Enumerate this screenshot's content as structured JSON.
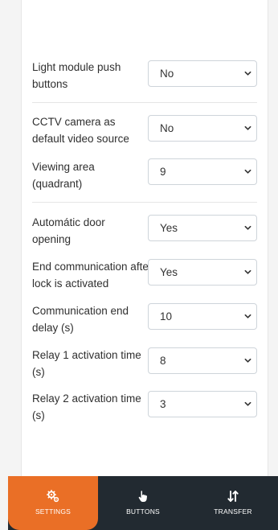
{
  "settings": [
    {
      "label": "Light module push buttons",
      "value": "No"
    },
    {
      "label": "CCTV camera as default video source",
      "value": "No"
    },
    {
      "label": "Viewing area (quadrant)",
      "value": "9"
    },
    {
      "label": "Automátic door opening",
      "value": "Yes"
    },
    {
      "label": "End communication after lock is activated",
      "value": "Yes"
    },
    {
      "label": "Communication end delay (s)",
      "value": "10"
    },
    {
      "label": "Relay 1 activation time (s)",
      "value": "8"
    },
    {
      "label": "Relay 2 activation time (s)",
      "value": "3"
    }
  ],
  "nav": {
    "settings": "SETTINGS",
    "buttons": "BUTTONS",
    "transfer": "TRANSFER"
  },
  "colors": {
    "accent": "#ea6f26",
    "nav_bg": "#222a31"
  },
  "icons": {
    "select": "chevron-down-icon",
    "settings": "gears-icon",
    "buttons": "hand-pointer-icon",
    "transfer": "sort-arrows-icon"
  }
}
